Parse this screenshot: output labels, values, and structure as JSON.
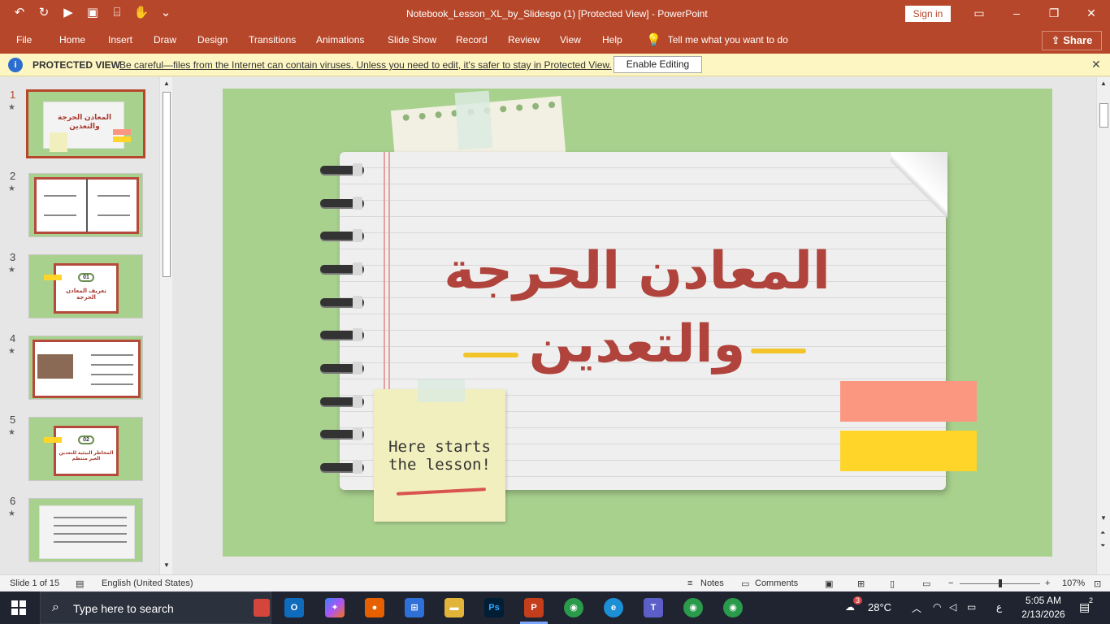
{
  "window": {
    "title": "Notebook_Lesson_XL_by_Slidesgo (1) [Protected View]  -  PowerPoint",
    "sign_in": "Sign in"
  },
  "ribbon": {
    "tabs": [
      "File",
      "Home",
      "Insert",
      "Draw",
      "Design",
      "Transitions",
      "Animations",
      "Slide Show",
      "Record",
      "Review",
      "View",
      "Help"
    ],
    "tell_me": "Tell me what you want to do",
    "share": "Share"
  },
  "protected_view": {
    "label": "PROTECTED VIEW",
    "message": "Be careful—files from the Internet can contain viruses. Unless you need to edit, it's safer to stay in Protected View.",
    "enable_button": "Enable Editing"
  },
  "thumbnails": [
    {
      "number": "1",
      "text": "المعادن الحرجة والتعدين"
    },
    {
      "number": "2",
      "text": ""
    },
    {
      "number": "3",
      "badge": "01",
      "text": "تعريف المعادن الحرجة"
    },
    {
      "number": "4",
      "text": ""
    },
    {
      "number": "5",
      "badge": "02",
      "text": "المخاطر البيئية للتعدين الغير منتظم"
    },
    {
      "number": "6",
      "text": ""
    }
  ],
  "slide": {
    "title_line1": "المعادن الحرجة",
    "title_line2": "والتعدين",
    "sticky_line1": "Here starts",
    "sticky_line2": "the lesson!"
  },
  "status": {
    "slide_count": "Slide 1 of 15",
    "language": "English (United States)",
    "notes": "Notes",
    "comments": "Comments",
    "zoom": "107%"
  },
  "taskbar": {
    "search_placeholder": "Type here to search",
    "temperature": "28°C",
    "time": "5:05 AM",
    "date": "2/13/2026",
    "notification_count": "2",
    "weather_badge": "3",
    "lang_indicator": "ع"
  },
  "colors": {
    "accent": "#b7472a",
    "slide_bg": "#a9d18e",
    "title_red": "#b0443d",
    "sticky": "#f1efbd",
    "tab_pink": "#fb9780",
    "tab_yellow": "#ffd52a"
  }
}
